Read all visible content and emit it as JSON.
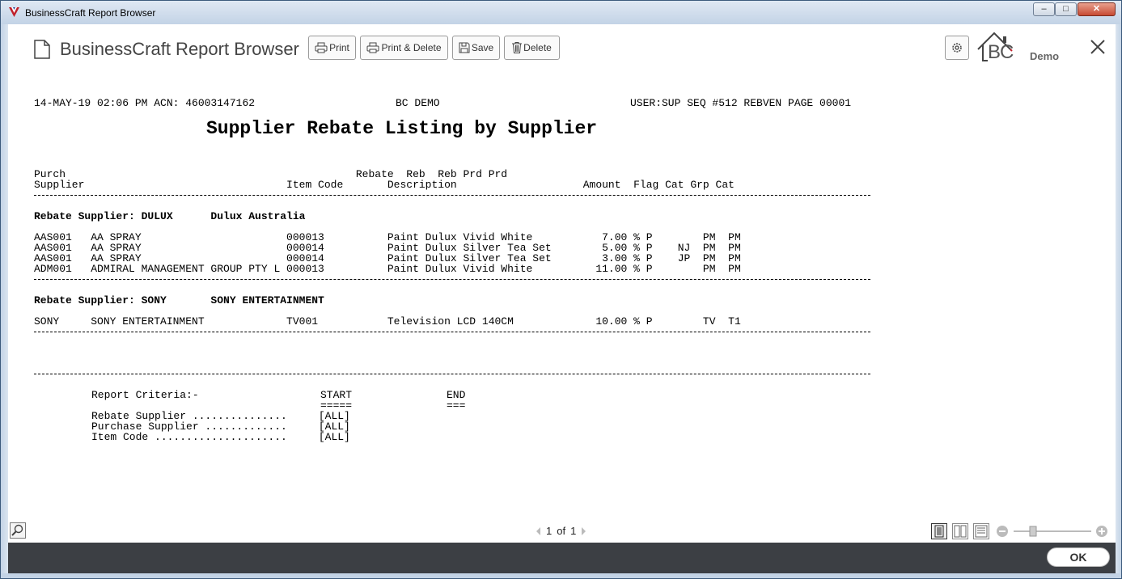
{
  "window": {
    "title": "BusinessCraft Report Browser",
    "min_label": "–",
    "max_label": "□",
    "close_label": "✕"
  },
  "header": {
    "title": "BusinessCraft Report Browser",
    "buttons": {
      "print": "Print",
      "print_delete": "Print & Delete",
      "save": "Save",
      "delete": "Delete"
    },
    "logo_text": "BC",
    "logo_sub": "Demo"
  },
  "report": {
    "meta_left": "14-MAY-19 02:06 PM ACN: 46003147162",
    "meta_center": "BC DEMO",
    "meta_right": "USER:SUP SEQ #512 REBVEN PAGE 00001",
    "title": "Supplier Rebate Listing by Supplier",
    "col_head_1": "Purch                                              Rebate  Reb  Reb Prd Prd",
    "col_head_2": "Supplier                                Item Code       Description                    Amount  Flag Cat Grp Cat",
    "groups": [
      {
        "heading": "Rebate Supplier: DULUX      Dulux Australia",
        "rows": [
          "AAS001   AA SPRAY                       000013          Paint Dulux Vivid White           7.00 % P        PM  PM",
          "AAS001   AA SPRAY                       000014          Paint Dulux Silver Tea Set        5.00 % P    NJ  PM  PM",
          "AAS001   AA SPRAY                       000014          Paint Dulux Silver Tea Set        3.00 % P    JP  PM  PM",
          "ADM001   ADMIRAL MANAGEMENT GROUP PTY L 000013          Paint Dulux Vivid White          11.00 % P        PM  PM"
        ]
      },
      {
        "heading": "Rebate Supplier: SONY       SONY ENTERTAINMENT",
        "rows": [
          "SONY     SONY ENTERTAINMENT             TV001           Television LCD 140CM             10.00 % P        TV  T1"
        ]
      }
    ],
    "criteria": {
      "label": "Report Criteria:-",
      "start": "START",
      "start_u": "=====",
      "end": "END",
      "end_u": "===",
      "lines": [
        "Rebate Supplier ...............     [ALL]",
        "Purchase Supplier .............     [ALL]",
        "Item Code .....................     [ALL]"
      ]
    }
  },
  "footer": {
    "page_current": "1",
    "page_of": "of",
    "page_total": "1"
  },
  "bottom": {
    "ok_label": "OK"
  }
}
